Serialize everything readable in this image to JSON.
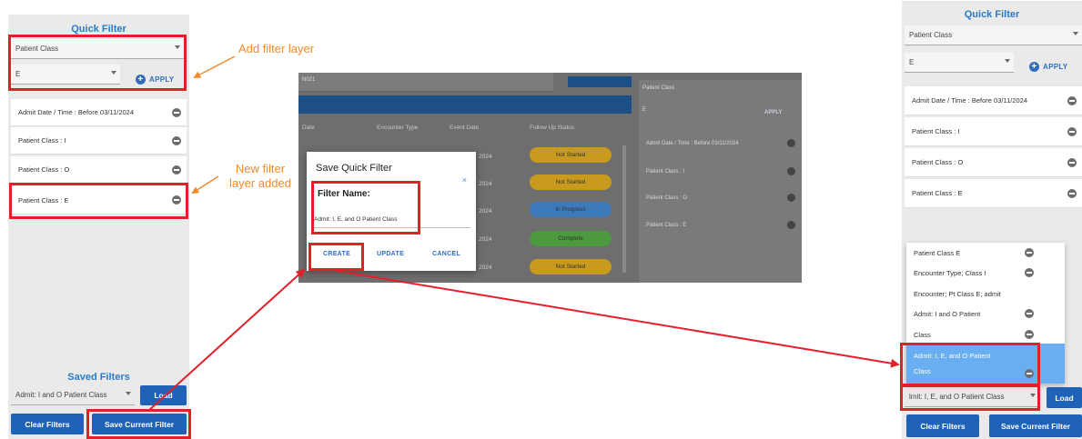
{
  "left_panel": {
    "quick_filter_title": "Quick Filter",
    "field_select": "Patient Class",
    "value_select": "E",
    "apply_label": "APPLY",
    "layers": [
      "Admit Date / Time : Before 03/11/2024",
      "Patient Class : I",
      "Patient Class : O",
      "Patient Class : E"
    ],
    "saved_filters_title": "Saved Filters",
    "saved_select": "Admit: I and O Patient Class",
    "load_label": "Load",
    "clear_label": "Clear Filters",
    "save_current_label": "Save Current Filter"
  },
  "callouts": {
    "add_layer": "Add filter layer",
    "new_layer_line1": "New filter",
    "new_layer_line2": "layer added"
  },
  "center": {
    "select_text": "N021",
    "headers": [
      "Date",
      "Encounter Type",
      "Event Date",
      "Follow Up Status"
    ],
    "pills": [
      {
        "label": "Not Started",
        "color": "#c89a1e"
      },
      {
        "label": "Not Started",
        "color": "#c89a1e"
      },
      {
        "label": "In Progress",
        "color": "#3c79b8"
      },
      {
        "label": "Complete",
        "color": "#4c9a3e"
      },
      {
        "label": "Not Started",
        "color": "#c89a1e"
      }
    ],
    "dates": [
      "2024",
      "2024",
      "2024",
      "2024",
      "2024"
    ],
    "right_panel": {
      "field": "Patient Class",
      "value": "E",
      "apply": "APPLY",
      "items": [
        "Admit Date / Time : Before 03/11/2024",
        "Patient Class : I",
        "Patient Class : O",
        "Patient Class : E"
      ]
    },
    "dialog": {
      "title": "Save Quick Filter",
      "close": "×",
      "field_label": "Filter Name:",
      "field_value": "Admit: I, E, and O Patient Class",
      "create": "CREATE",
      "update": "UPDATE",
      "cancel": "CANCEL"
    }
  },
  "right_panel": {
    "quick_filter_title": "Quick Filter",
    "field_select": "Patient Class",
    "value_select": "E",
    "apply_label": "APPLY",
    "layers": [
      "Admit Date / Time : Before 03/11/2024",
      "Patient Class : I",
      "Patient Class : O",
      "Patient Class : E"
    ],
    "saved_list": [
      "Patient Class E",
      "Encounter Type; Class I",
      "Encounter; Pt Class E; admit",
      "Admit: I and O Patient",
      "Class"
    ],
    "saved_selected_line1": "Admit: I, E, and O Patient",
    "saved_selected_line2": "Class",
    "saved_select": "lmit: I, E, and O Patient Class",
    "load_label": "Load",
    "clear_label": "Clear Filters",
    "save_current_label": "Save Current Filter"
  },
  "colors": {
    "accent_blue": "#1f63b8",
    "title_blue": "#2b7bc4",
    "highlight_red": "#e2202a",
    "callout_orange": "#f08a2c",
    "selected_row": "#69aef0"
  }
}
